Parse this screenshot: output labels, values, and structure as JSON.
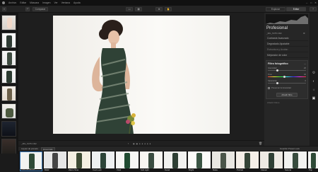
{
  "menu": {
    "items": [
      "Archivo",
      "Editar",
      "Máscara",
      "Imagen",
      "Ver",
      "Ventana",
      "Ayuda"
    ],
    "window_controls": [
      "–",
      "□",
      "✕"
    ]
  },
  "toolbar": {
    "compare_label": "Comparar",
    "tab_explore": "Explorar",
    "tab_edit": "Editar"
  },
  "panel": {
    "title": "Profesional",
    "file_name": "_MG_5475.CR2",
    "items": [
      "Contraste Avanzado",
      "Degradado Ajustable",
      "Estructura y Acutan",
      "Mejorador de color"
    ],
    "filter_title": "Filtro fotográfico",
    "sliders": [
      {
        "label": "Intensidad",
        "value": "20"
      },
      {
        "label": "Tono",
        "value": "40"
      },
      {
        "label": "Saturación",
        "value": "0"
      }
    ],
    "checkbox_label": "Preservar luminosidad",
    "add_filter_button": "Añadir filtro",
    "footer_label": "Añadir Filtros"
  },
  "canvas": {
    "file_label": "_MG_5475.CR2",
    "nav_dots": "◉ ◉ ● ● ● ● ●"
  },
  "presets": {
    "category": "Layout de presets",
    "filter": "Essentials",
    "right_label": "Guardar Preset Look",
    "items": [
      {
        "label": "Color Enhancer"
      },
      {
        "label": "B&W"
      },
      {
        "label": "Warm Tone"
      },
      {
        "label": "Cool Look"
      },
      {
        "label": "Vivid"
      },
      {
        "label": "Soft Light"
      },
      {
        "label": "Detail"
      },
      {
        "label": "Bright"
      },
      {
        "label": "Matte"
      },
      {
        "label": "Portrait"
      },
      {
        "label": "Classic"
      },
      {
        "label": "Natural"
      },
      {
        "label": "Pop"
      }
    ]
  },
  "colors": {
    "accent": "#3d7ab8",
    "panel_bg": "#262626",
    "canvas_bg": "#1e1e1e"
  }
}
